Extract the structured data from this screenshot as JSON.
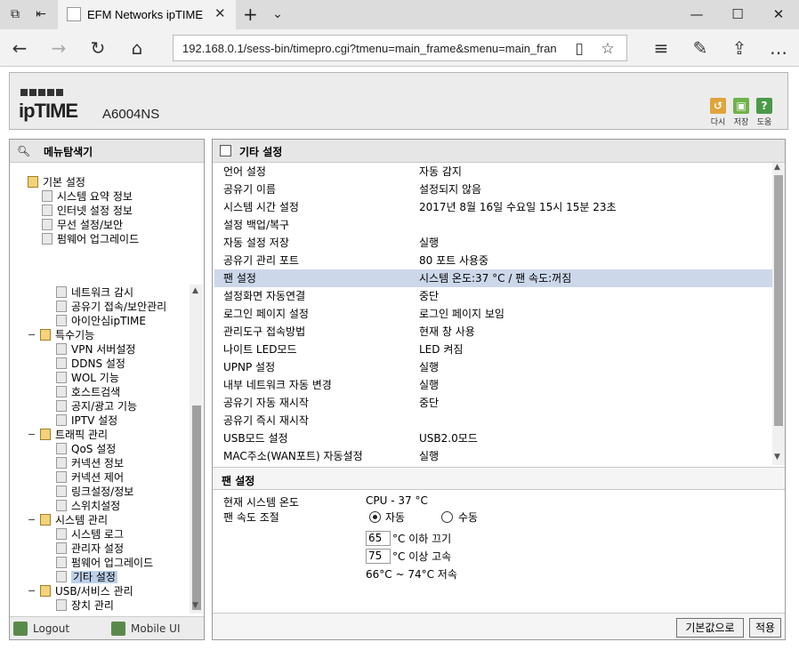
{
  "browser": {
    "tab_title": "EFM Networks ipTIME A",
    "url": "192.168.0.1/sess-bin/timepro.cgi?tmenu=main_frame&smenu=main_fran",
    "icons": [
      "tab-manager-icon",
      "set-aside-icon",
      "close-icon",
      "new-tab-icon",
      "chevron-down-icon",
      "minimize-icon",
      "maximize-icon",
      "window-close-icon",
      "back-icon",
      "forward-icon",
      "refresh-icon",
      "home-icon",
      "reading-view-icon",
      "favorite-star-icon",
      "hub-icon",
      "pen-icon",
      "share-icon",
      "more-icon"
    ]
  },
  "header": {
    "logo": "ipTIME",
    "model": "A6004NS",
    "buttons": [
      {
        "label": "다시",
        "color": "#e0a43a",
        "glyph": "↺"
      },
      {
        "label": "저장",
        "color": "#6fb24a",
        "glyph": "▣"
      },
      {
        "label": "도움",
        "color": "#4a9a48",
        "glyph": "?"
      }
    ]
  },
  "sidebar": {
    "title": "메뉴탐색기",
    "top_items": [
      {
        "label": "기본 설정",
        "type": "folder"
      },
      {
        "label": "시스템 요약 정보",
        "type": "leaf"
      },
      {
        "label": "인터넷 설정 정보",
        "type": "leaf"
      },
      {
        "label": "무선 설정/보안",
        "type": "leaf"
      },
      {
        "label": "펌웨어 업그레이드",
        "type": "leaf"
      }
    ],
    "tree": [
      {
        "label": "네트워크 감시",
        "type": "leaf"
      },
      {
        "label": "공유기 접속/보안관리",
        "type": "leaf"
      },
      {
        "label": "아이안심ipTIME",
        "type": "leaf"
      },
      {
        "label": "특수기능",
        "type": "folder"
      },
      {
        "label": "VPN 서버설정",
        "type": "leaf"
      },
      {
        "label": "DDNS 설정",
        "type": "leaf"
      },
      {
        "label": "WOL 기능",
        "type": "leaf"
      },
      {
        "label": "호스트검색",
        "type": "leaf"
      },
      {
        "label": "공지/광고 기능",
        "type": "leaf"
      },
      {
        "label": "IPTV 설정",
        "type": "leaf"
      },
      {
        "label": "트래픽 관리",
        "type": "folder"
      },
      {
        "label": "QoS 설정",
        "type": "leaf"
      },
      {
        "label": "커넥션 정보",
        "type": "leaf"
      },
      {
        "label": "커넥션 제어",
        "type": "leaf"
      },
      {
        "label": "링크설정/정보",
        "type": "leaf"
      },
      {
        "label": "스위치설정",
        "type": "leaf"
      },
      {
        "label": "시스템 관리",
        "type": "folder"
      },
      {
        "label": "시스템 로그",
        "type": "leaf"
      },
      {
        "label": "관리자 설정",
        "type": "leaf"
      },
      {
        "label": "펌웨어 업그레이드",
        "type": "leaf"
      },
      {
        "label": "기타 설정",
        "type": "leaf",
        "selected": true
      },
      {
        "label": "USB/서비스 관리",
        "type": "folder"
      },
      {
        "label": "장치 관리",
        "type": "leaf"
      }
    ],
    "footer": {
      "logout": "Logout",
      "mobile": "Mobile UI"
    }
  },
  "main": {
    "title": "기타 설정",
    "rows": [
      {
        "k": "언어 설정",
        "v": "자동 감지"
      },
      {
        "k": "공유기 이름",
        "v": "설정되지 않음"
      },
      {
        "k": "시스템 시간 설정",
        "v": "2017년 8월 16일 수요일 15시 15분 23초"
      },
      {
        "k": "설정 백업/복구",
        "v": ""
      },
      {
        "k": "자동 설정 저장",
        "v": "실행"
      },
      {
        "k": "공유기 관리 포트",
        "v": "80 포트 사용중"
      },
      {
        "k": "팬 설정",
        "v": "시스템 온도:37 °C / 팬 속도:꺼짐",
        "hl": true
      },
      {
        "k": "설정화면 자동연결",
        "v": "중단"
      },
      {
        "k": "로그인 페이지 설정",
        "v": "로그인 페이지 보임"
      },
      {
        "k": "관리도구 접속방법",
        "v": "현재 창 사용"
      },
      {
        "k": "나이트 LED모드",
        "v": "LED 켜짐"
      },
      {
        "k": "UPNP 설정",
        "v": "실행"
      },
      {
        "k": "내부 네트워크 자동 변경",
        "v": "실행"
      },
      {
        "k": "공유기 자동 재시작",
        "v": "중단"
      },
      {
        "k": "공유기 즉시 재시작",
        "v": ""
      },
      {
        "k": "USB모드 설정",
        "v": "USB2.0모드"
      },
      {
        "k": "MAC주소(WAN포트) 자동설정",
        "v": "실행"
      }
    ],
    "fan": {
      "title": "팬 설정",
      "temp_label": "현재 시스템 온도",
      "temp_value": "CPU - 37 °C",
      "speed_label": "팬 속도 조절",
      "auto": "자동",
      "manual": "수동",
      "off_value": "65",
      "off_suffix": "°C 이하 끄기",
      "high_value": "75",
      "high_suffix": "°C 이상 고속",
      "range": "66°C ~ 74°C 저속",
      "default_btn": "기본값으로",
      "apply_btn": "적용"
    }
  }
}
